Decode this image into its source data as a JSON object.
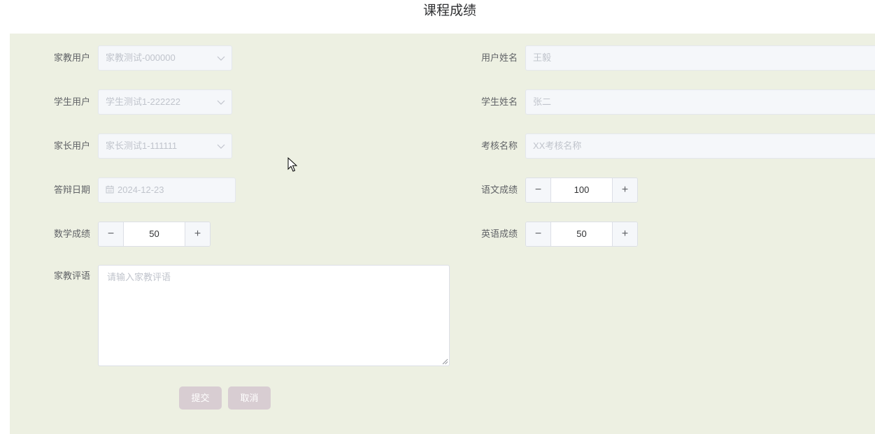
{
  "page": {
    "title": "课程成绩"
  },
  "form": {
    "tutor_user": {
      "label": "家教用户",
      "value": "家教测试-000000"
    },
    "user_name": {
      "label": "用户姓名",
      "value": "王毅"
    },
    "student_user": {
      "label": "学生用户",
      "value": "学生测试1-222222"
    },
    "student_name": {
      "label": "学生姓名",
      "value": "张二"
    },
    "parent_user": {
      "label": "家长用户",
      "value": "家长测试1-111111"
    },
    "exam_name": {
      "label": "考核名称",
      "value": "XX考核名称"
    },
    "defense_date": {
      "label": "答辩日期",
      "value": "2024-12-23"
    },
    "chinese_score": {
      "label": "语文成绩",
      "value": "100",
      "minus": "−",
      "plus": "+"
    },
    "math_score": {
      "label": "数学成绩",
      "value": "50",
      "minus": "−",
      "plus": "+"
    },
    "english_score": {
      "label": "英语成绩",
      "value": "50",
      "minus": "−",
      "plus": "+"
    },
    "tutor_comment": {
      "label": "家教评语",
      "placeholder": "请输入家教评语"
    }
  },
  "actions": {
    "submit_label": "提交",
    "cancel_label": "取消"
  },
  "icons": {
    "select_arrow": "chevron-down-icon",
    "date": "calendar-icon",
    "cursor": "mouse-pointer-icon"
  },
  "colors": {
    "panel_bg": "#edf0e2",
    "button_bg": "#d8cdd2",
    "disabled_field_bg": "#f5f7fa"
  }
}
